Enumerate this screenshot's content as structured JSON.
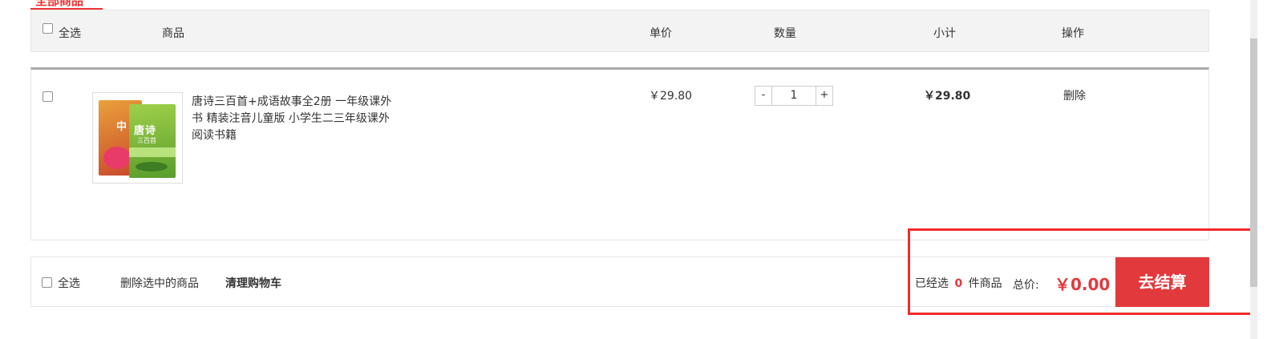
{
  "tab": {
    "label": "全部商品"
  },
  "header": {
    "select_all": "全选",
    "product": "商品",
    "unit_price": "单价",
    "quantity": "数量",
    "subtotal": "小计",
    "action": "操作"
  },
  "items": [
    {
      "title": "唐诗三百首+成语故事全2册 一年级课外书 精装注音儿童版 小学生二三年级课外阅读书籍",
      "cover_text_left": "中",
      "cover_text_right": "唐诗",
      "cover_sub": "三百首",
      "price": "￥29.80",
      "qty_minus": "-",
      "quantity": "1",
      "qty_plus": "+",
      "subtotal": "￥29.80",
      "delete": "删除"
    }
  ],
  "footer": {
    "select_all": "全选",
    "delete_selected": "删除选中的商品",
    "clear_cart": "清理购物车",
    "selected_prefix": "已经选",
    "selected_count": "0",
    "selected_suffix": "件商品",
    "total_label": "总价:",
    "total_value": "￥0.00",
    "checkout": "去结算"
  },
  "colors": {
    "accent": "#e2393c",
    "highlight": "#f12c2c"
  }
}
